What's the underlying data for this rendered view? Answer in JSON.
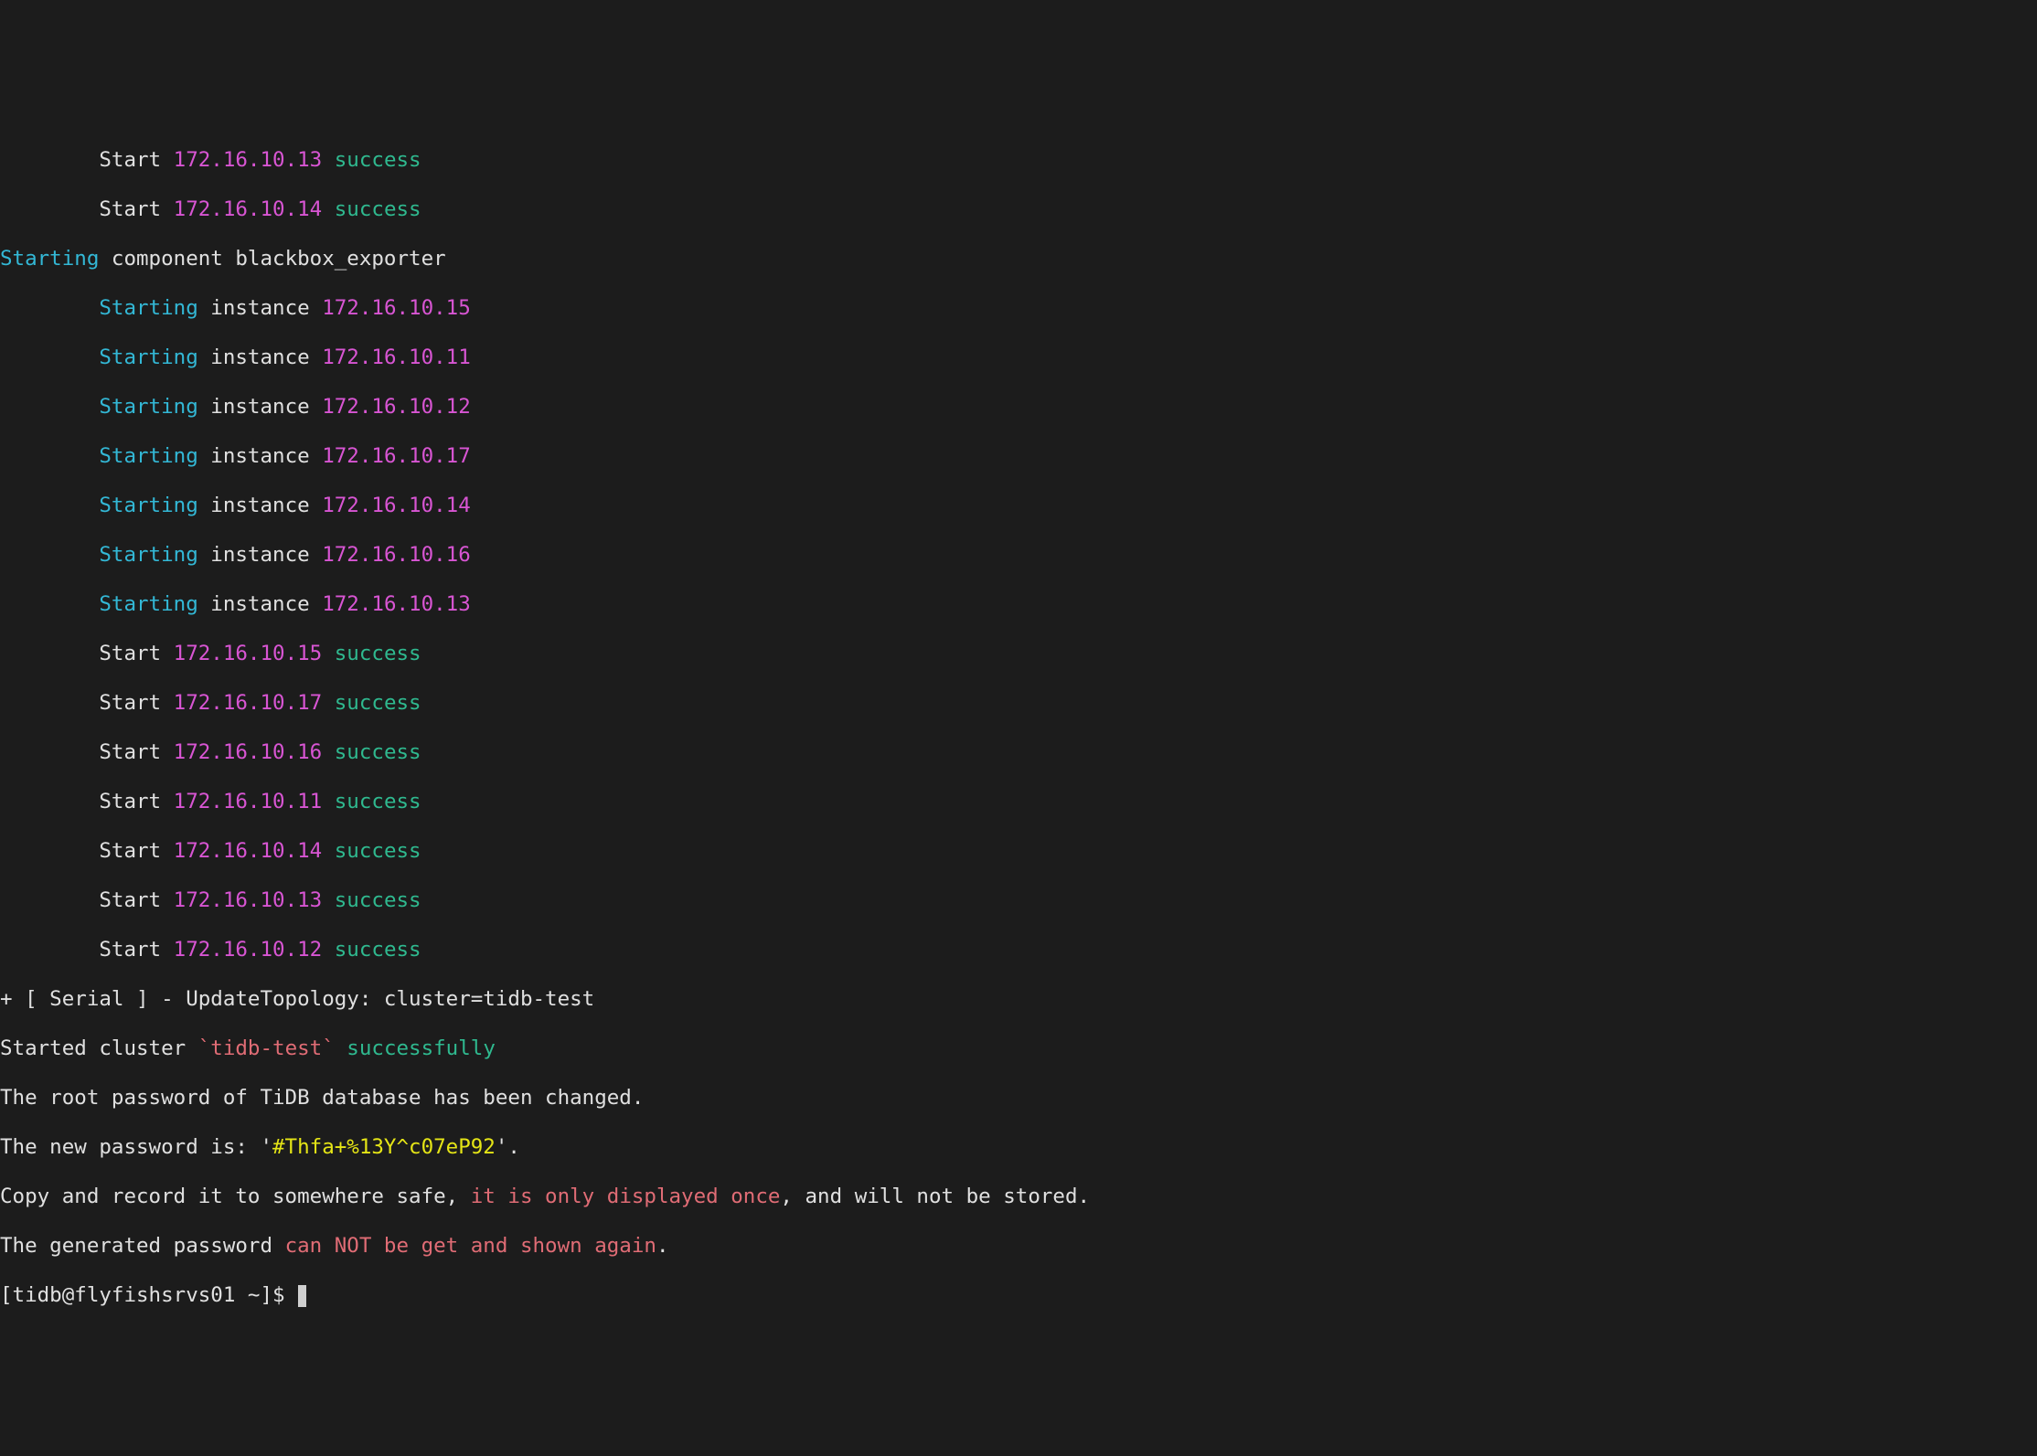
{
  "lines": {
    "l0": {
      "prefix": "        ",
      "action": "Start",
      "ip": "172.16.10.13",
      "suffix": "success"
    },
    "l1": {
      "prefix": "        ",
      "action": "Start",
      "ip": "172.16.10.14",
      "suffix": "success"
    },
    "l2": {
      "head": "Starting",
      "mid": " component blackbox_exporter"
    },
    "l3": {
      "prefix": "        ",
      "action": "Starting",
      "mid": " instance ",
      "ip": "172.16.10.15"
    },
    "l4": {
      "prefix": "        ",
      "action": "Starting",
      "mid": " instance ",
      "ip": "172.16.10.11"
    },
    "l5": {
      "prefix": "        ",
      "action": "Starting",
      "mid": " instance ",
      "ip": "172.16.10.12"
    },
    "l6": {
      "prefix": "        ",
      "action": "Starting",
      "mid": " instance ",
      "ip": "172.16.10.17"
    },
    "l7": {
      "prefix": "        ",
      "action": "Starting",
      "mid": " instance ",
      "ip": "172.16.10.14"
    },
    "l8": {
      "prefix": "        ",
      "action": "Starting",
      "mid": " instance ",
      "ip": "172.16.10.16"
    },
    "l9": {
      "prefix": "        ",
      "action": "Starting",
      "mid": " instance ",
      "ip": "172.16.10.13"
    },
    "l10": {
      "prefix": "        ",
      "action": "Start",
      "ip": "172.16.10.15",
      "suffix": "success"
    },
    "l11": {
      "prefix": "        ",
      "action": "Start",
      "ip": "172.16.10.17",
      "suffix": "success"
    },
    "l12": {
      "prefix": "        ",
      "action": "Start",
      "ip": "172.16.10.16",
      "suffix": "success"
    },
    "l13": {
      "prefix": "        ",
      "action": "Start",
      "ip": "172.16.10.11",
      "suffix": "success"
    },
    "l14": {
      "prefix": "        ",
      "action": "Start",
      "ip": "172.16.10.14",
      "suffix": "success"
    },
    "l15": {
      "prefix": "        ",
      "action": "Start",
      "ip": "172.16.10.13",
      "suffix": "success"
    },
    "l16": {
      "prefix": "        ",
      "action": "Start",
      "ip": "172.16.10.12",
      "suffix": "success"
    },
    "l17": {
      "text": "+ [ Serial ] - UpdateTopology: cluster=tidb-test"
    },
    "l18": {
      "a": "Started cluster ",
      "b": "`tidb-test`",
      "c": " successfully"
    },
    "l19": {
      "text": "The root password of TiDB database has been changed."
    },
    "l20": {
      "a": "The new password is: '",
      "b": "#Thfa+%13Y^c07eP92",
      "c": "'."
    },
    "l21": {
      "a": "Copy and record it to somewhere safe, ",
      "b": "it is only displayed once",
      "c": ", and will not be stored."
    },
    "l22": {
      "a": "The generated password ",
      "b": "can NOT be get and shown again",
      "c": "."
    },
    "l23": {
      "prompt": "[tidb@flyfishsrvs01 ~]$ "
    }
  }
}
